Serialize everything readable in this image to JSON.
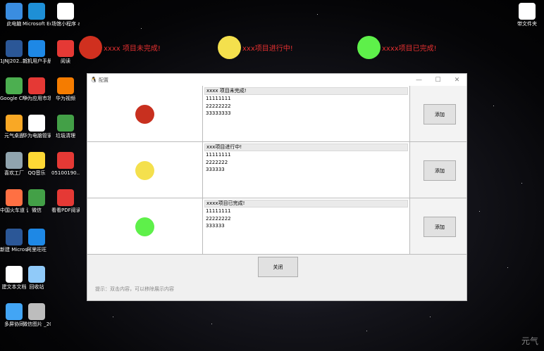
{
  "desktop": {
    "icons": [
      {
        "label": "此电脑",
        "icon": "computer-icon",
        "color": "#3a8de0"
      },
      {
        "label": "Microsoft Edge",
        "icon": "edge-icon",
        "color": "#1e8fd6"
      },
      {
        "label": "场馆小程序 app(安卓...",
        "icon": "file-icon",
        "color": "#ffffff"
      },
      {
        "label": "1JNJ202... 江市市中...",
        "icon": "word-icon",
        "color": "#2b5797"
      },
      {
        "label": "新机用户手册",
        "icon": "book-icon",
        "color": "#1e88e5"
      },
      {
        "label": "阅读",
        "icon": "reader-icon",
        "color": "#e53935"
      },
      {
        "label": "Google Chrome",
        "icon": "chrome-icon",
        "color": "#4caf50"
      },
      {
        "label": "华为应用市场",
        "icon": "huawei-appgallery-icon",
        "color": "#e53935"
      },
      {
        "label": "华为视频",
        "icon": "huawei-video-icon",
        "color": "#f57c00"
      },
      {
        "label": "元气桌面",
        "icon": "yuanqi-icon",
        "color": "#f9a825"
      },
      {
        "label": "华为电脑管家",
        "icon": "pc-manager-icon",
        "color": "#ffffff"
      },
      {
        "label": "垃圾清理",
        "icon": "cleanup-icon",
        "color": "#43a047"
      },
      {
        "label": "喜欢工厂",
        "icon": "factory-icon",
        "color": "#90a4ae"
      },
      {
        "label": "QQ音乐",
        "icon": "qqmusic-icon",
        "color": "#fdd835"
      },
      {
        "label": "05100190...",
        "icon": "pdf-icon",
        "color": "#e53935"
      },
      {
        "label": "中国火车道 调整系统",
        "icon": "train-icon",
        "color": "#ff7043"
      },
      {
        "label": "微信",
        "icon": "wechat-icon",
        "color": "#43a047"
      },
      {
        "label": "看看PDF阅读器",
        "icon": "pdf-reader-icon",
        "color": "#e53935"
      },
      {
        "label": "新建 Microsof...",
        "icon": "word-icon",
        "color": "#2b5797"
      },
      {
        "label": "阿里旺旺",
        "icon": "aliwangwang-icon",
        "color": "#1e88e5"
      },
      {
        "label": "建文本文档",
        "icon": "text-doc-icon",
        "color": "#ffffff"
      },
      {
        "label": "回收站",
        "icon": "recycle-bin-icon",
        "color": "#90caf9"
      },
      {
        "label": "多屏协同",
        "icon": "multiscreen-icon",
        "color": "#42a5f5"
      },
      {
        "label": "微信图片 _2022011...",
        "icon": "photo-icon",
        "color": "#bdbdbd"
      },
      {
        "label": "带文件夹",
        "icon": "folder-cat-icon",
        "color": "#ffffff"
      }
    ]
  },
  "legend": [
    {
      "label": "xxxx 项目未完成!",
      "color": "#d0301f"
    },
    {
      "label": "xxx项目进行中!",
      "color": "#f4e04d"
    },
    {
      "label": "xxxx项目已完成!",
      "color": "#5ef04a"
    }
  ],
  "dialog": {
    "title": "配置",
    "rows": [
      {
        "color": "#c8301f",
        "header": "xxxx 项目未完成!",
        "lines": [
          "11111111",
          "22222222",
          "33333333"
        ],
        "button": "添加"
      },
      {
        "color": "#f4e04d",
        "header": "xxx项目进行中!",
        "lines": [
          "11111111",
          "2222222",
          "333333"
        ],
        "button": "添加"
      },
      {
        "color": "#5ef04a",
        "header": "xxxx项目已完成!",
        "lines": [
          "11111111",
          "22222222",
          "333333"
        ],
        "button": "添加"
      }
    ],
    "close_label": "关闭",
    "hint": "提示：双击内容，可以移除展示内容"
  },
  "watermark": "元气"
}
